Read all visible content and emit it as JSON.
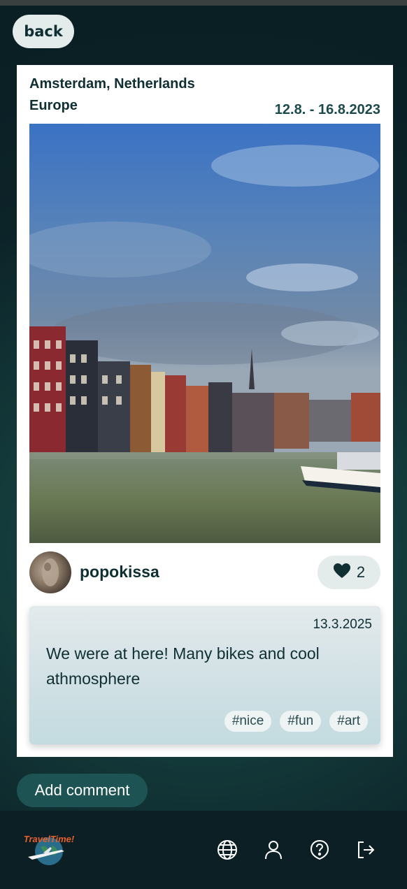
{
  "back_label": "back",
  "post": {
    "city": "Amsterdam, Netherlands",
    "region": "Europe",
    "dates": "12.8. - 16.8.2023",
    "author": "popokissa",
    "likes": "2"
  },
  "comment": {
    "date": "13.3.2025",
    "text": "We were at here! Many bikes and cool athmosphere",
    "tags": [
      "#nice",
      "#fun",
      "#art"
    ]
  },
  "add_comment_label": "Add comment",
  "footer": {
    "logo_text": "TravelTime!",
    "icons": [
      "globe-icon",
      "user-icon",
      "help-icon",
      "logout-icon"
    ]
  },
  "colors": {
    "accent": "#1d5352",
    "text": "#0f2f33",
    "footer_bg": "#0b1f24"
  }
}
